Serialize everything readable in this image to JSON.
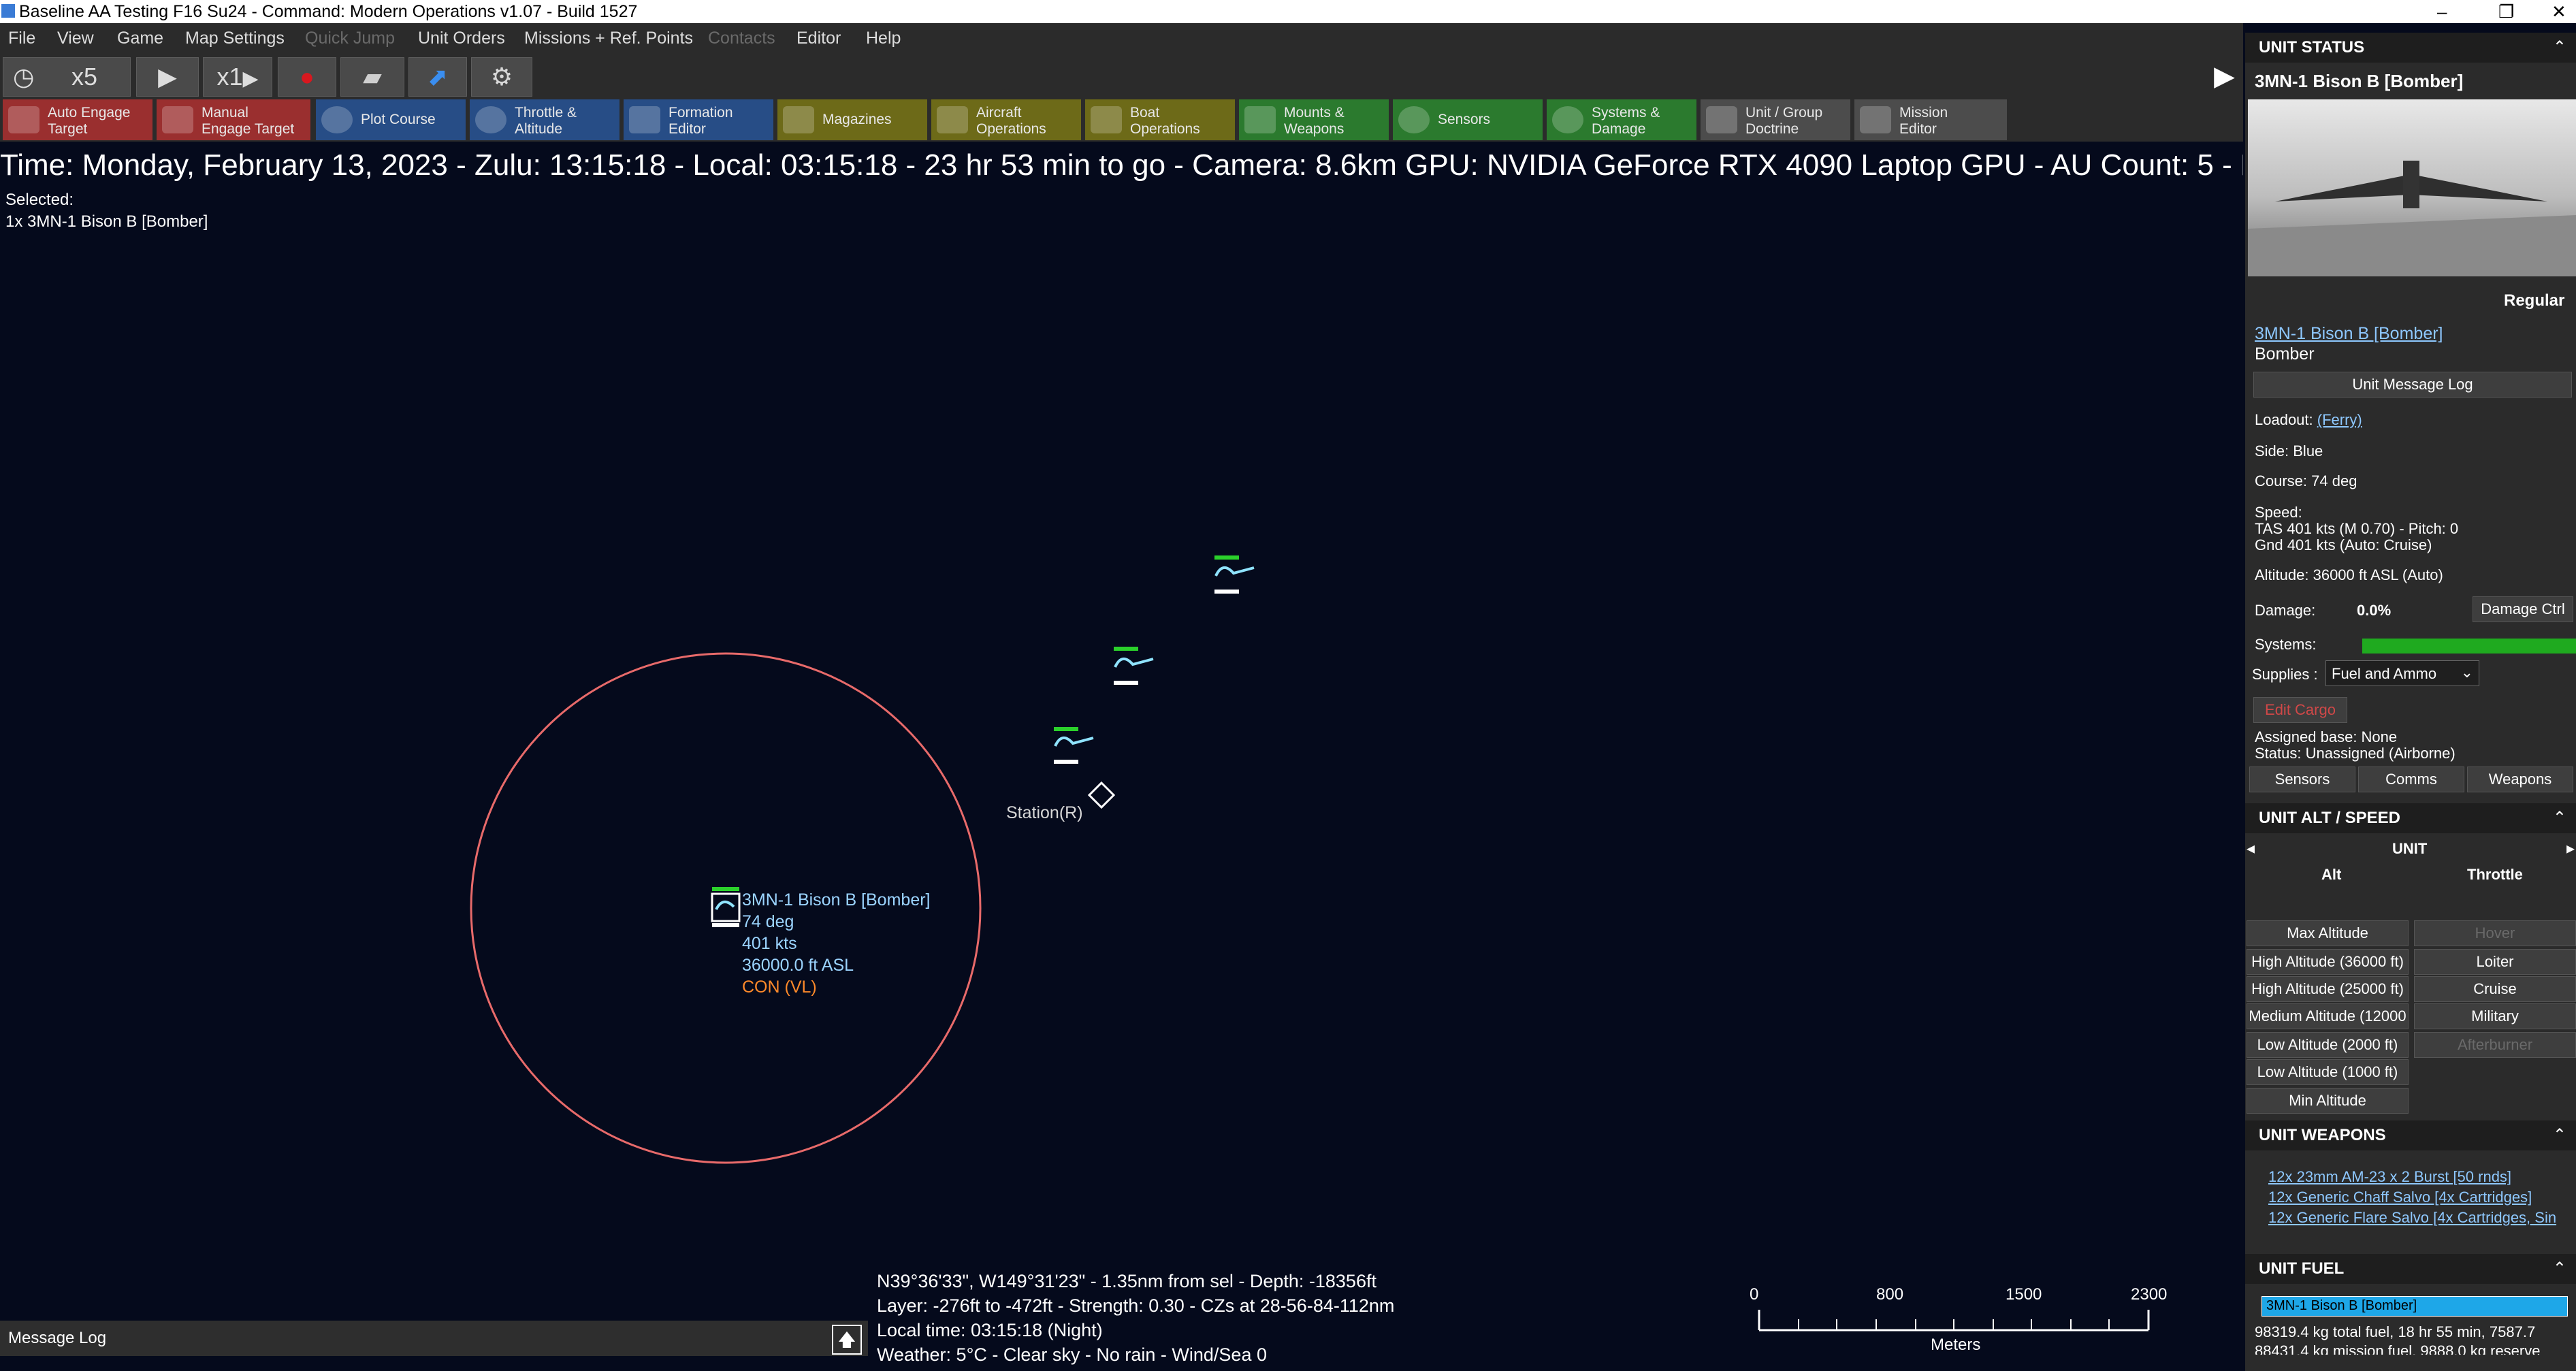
{
  "window": {
    "title": "Baseline AA Testing F16 Su24 - Command: Modern Operations v1.07 - Build 1527",
    "minimize": "–",
    "restore": "❐",
    "close": "✕"
  },
  "menu": [
    "File",
    "View",
    "Game",
    "Map Settings",
    "Quick Jump",
    "Unit Orders",
    "Missions + Ref. Points",
    "Contacts",
    "Editor",
    "Help"
  ],
  "time_controls": {
    "speed_a": "x5",
    "speed_b": "x1"
  },
  "toolbar": [
    {
      "label": "Auto Engage Target",
      "l1": "Auto Engage",
      "l2": "Target"
    },
    {
      "label": "Manual Engage Target",
      "l1": "Manual",
      "l2": "Engage Target"
    },
    {
      "label": "Plot Course"
    },
    {
      "label": "Throttle & Altitude",
      "l1": "Throttle &",
      "l2": "Altitude"
    },
    {
      "label": "Formation Editor",
      "l1": "Formation",
      "l2": "Editor"
    },
    {
      "label": "Magazines"
    },
    {
      "label": "Aircraft Operations",
      "l1": "Aircraft",
      "l2": "Operations"
    },
    {
      "label": "Boat Operations",
      "l1": "Boat",
      "l2": "Operations"
    },
    {
      "label": "Mounts & Weapons",
      "l1": "Mounts &",
      "l2": "Weapons"
    },
    {
      "label": "Sensors"
    },
    {
      "label": "Systems & Damage",
      "l1": "Systems &",
      "l2": "Damage"
    },
    {
      "label": "Unit / Group Doctrine",
      "l1": "Unit / Group",
      "l2": "Doctrine"
    },
    {
      "label": "Mission Editor",
      "l1": "Mission",
      "l2": "Editor"
    }
  ],
  "info_bar": "Time: Monday, February 13, 2023 - Zulu: 13:15:18 - Local: 03:15:18 - 23 hr 53 min to go - Camera: 8.6km GPU: NVIDIA GeForce RTX 4090 Laptop GPU - AU Count: 5 - P",
  "selection": {
    "label": "Selected:",
    "unit": "1x 3MN-1 Bison B [Bomber]"
  },
  "map": {
    "unit_label": "3MN-1 Bison B [Bomber]",
    "unit_course": "74 deg",
    "unit_speed": "401 kts",
    "unit_alt": "36000.0 ft ASL",
    "unit_status": "CON (VL)",
    "station_label": "Station(R)"
  },
  "cursor_info": {
    "line1": "N39°36'33\", W149°31'23\" - 1.35nm from sel - Depth: -18356ft",
    "line2": "Layer: -276ft to -472ft - Strength: 0.30 - CZs at 28-56-84-112nm",
    "line3": "Local time: 03:15:18 (Night)",
    "line4": "Weather: 5°C - Clear sky - No rain - Wind/Sea 0"
  },
  "scale_bar": {
    "ticks": [
      "0",
      "800",
      "1500",
      "2300"
    ],
    "unit": "Meters"
  },
  "message_log": {
    "label": "Message Log"
  },
  "unit_status": {
    "header": "UNIT STATUS",
    "name": "3MN-1 Bison B [Bomber]",
    "proficiency": "Regular",
    "name_link": "3MN-1 Bison B [Bomber]",
    "type": "Bomber",
    "msg_log_button": "Unit Message Log",
    "loadout_label": "Loadout:",
    "loadout_value": "(Ferry)",
    "side": "Side: Blue",
    "course": "Course: 74 deg",
    "speed_label": "Speed:",
    "tas": "TAS 401 kts (M 0.70) - Pitch: 0",
    "gnd": "Gnd 401 kts (Auto: Cruise)",
    "altitude": "Altitude: 36000 ft ASL (Auto)",
    "damage_label": "Damage:",
    "damage_value": "0.0%",
    "damage_ctrl": "Damage Ctrl",
    "systems_label": "Systems:",
    "systems_level": 1.0,
    "supplies_label": "Supplies :",
    "supplies_value": "Fuel and Ammo",
    "edit_cargo": "Edit Cargo",
    "assigned_base": "Assigned base: None",
    "status": "Status: Unassigned (Airborne)",
    "tabs": [
      "Sensors",
      "Comms",
      "Weapons"
    ]
  },
  "alt_speed": {
    "header": "UNIT ALT / SPEED",
    "unit_label": "UNIT",
    "alt_label": "Alt",
    "throttle_label": "Throttle",
    "alt_buttons": [
      "Max Altitude",
      "High Altitude (36000 ft)",
      "High Altitude (25000 ft)",
      "Medium Altitude (12000",
      "Low Altitude (2000 ft)",
      "Low Altitude (1000 ft)",
      "Min Altitude"
    ],
    "throttle_buttons": [
      "Hover",
      "Loiter",
      "Cruise",
      "Military",
      "Afterburner"
    ]
  },
  "weapons": {
    "header": "UNIT WEAPONS",
    "items": [
      "12x 23mm AM-23 x 2 Burst [50 rnds]",
      "12x Generic Chaff Salvo [4x Cartridges]",
      "12x Generic Flare Salvo [4x Cartridges, Sin"
    ]
  },
  "fuel": {
    "header": "UNIT FUEL",
    "bar_label": "3MN-1 Bison B [Bomber]",
    "line1": "98319.4 kg total fuel, 18 hr 55 min, 7587.7",
    "line2": "88431.4 kg mission fuel, 9888.0 kg reserve"
  },
  "colors": {
    "range_ring": "#e86a6a",
    "friendly": "#2bd12b",
    "track": "#8fe3ff",
    "status_orange": "#ff8a2a",
    "systems_bar": "#1faa1f",
    "fuel_bar": "#1ea7e8"
  }
}
